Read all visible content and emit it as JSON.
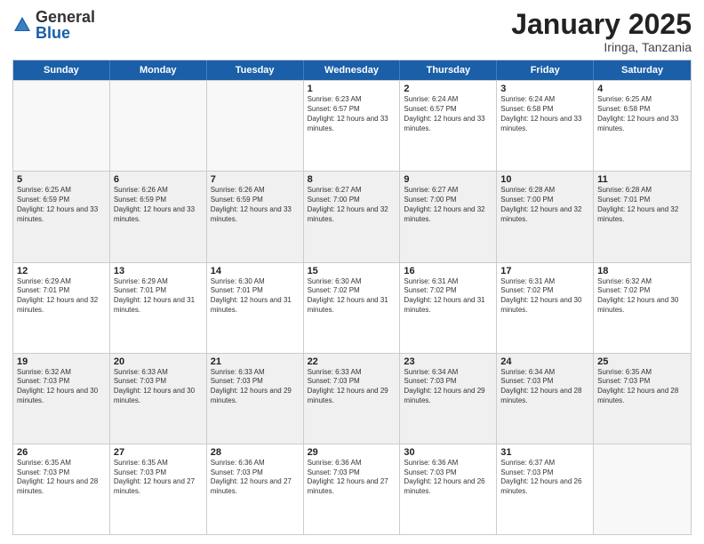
{
  "header": {
    "logo_general": "General",
    "logo_blue": "Blue",
    "title": "January 2025",
    "location": "Iringa, Tanzania"
  },
  "days_of_week": [
    "Sunday",
    "Monday",
    "Tuesday",
    "Wednesday",
    "Thursday",
    "Friday",
    "Saturday"
  ],
  "weeks": [
    [
      {
        "day": "",
        "text": ""
      },
      {
        "day": "",
        "text": ""
      },
      {
        "day": "",
        "text": ""
      },
      {
        "day": "1",
        "text": "Sunrise: 6:23 AM\nSunset: 6:57 PM\nDaylight: 12 hours and 33 minutes."
      },
      {
        "day": "2",
        "text": "Sunrise: 6:24 AM\nSunset: 6:57 PM\nDaylight: 12 hours and 33 minutes."
      },
      {
        "day": "3",
        "text": "Sunrise: 6:24 AM\nSunset: 6:58 PM\nDaylight: 12 hours and 33 minutes."
      },
      {
        "day": "4",
        "text": "Sunrise: 6:25 AM\nSunset: 6:58 PM\nDaylight: 12 hours and 33 minutes."
      }
    ],
    [
      {
        "day": "5",
        "text": "Sunrise: 6:25 AM\nSunset: 6:59 PM\nDaylight: 12 hours and 33 minutes."
      },
      {
        "day": "6",
        "text": "Sunrise: 6:26 AM\nSunset: 6:59 PM\nDaylight: 12 hours and 33 minutes."
      },
      {
        "day": "7",
        "text": "Sunrise: 6:26 AM\nSunset: 6:59 PM\nDaylight: 12 hours and 33 minutes."
      },
      {
        "day": "8",
        "text": "Sunrise: 6:27 AM\nSunset: 7:00 PM\nDaylight: 12 hours and 32 minutes."
      },
      {
        "day": "9",
        "text": "Sunrise: 6:27 AM\nSunset: 7:00 PM\nDaylight: 12 hours and 32 minutes."
      },
      {
        "day": "10",
        "text": "Sunrise: 6:28 AM\nSunset: 7:00 PM\nDaylight: 12 hours and 32 minutes."
      },
      {
        "day": "11",
        "text": "Sunrise: 6:28 AM\nSunset: 7:01 PM\nDaylight: 12 hours and 32 minutes."
      }
    ],
    [
      {
        "day": "12",
        "text": "Sunrise: 6:29 AM\nSunset: 7:01 PM\nDaylight: 12 hours and 32 minutes."
      },
      {
        "day": "13",
        "text": "Sunrise: 6:29 AM\nSunset: 7:01 PM\nDaylight: 12 hours and 31 minutes."
      },
      {
        "day": "14",
        "text": "Sunrise: 6:30 AM\nSunset: 7:01 PM\nDaylight: 12 hours and 31 minutes."
      },
      {
        "day": "15",
        "text": "Sunrise: 6:30 AM\nSunset: 7:02 PM\nDaylight: 12 hours and 31 minutes."
      },
      {
        "day": "16",
        "text": "Sunrise: 6:31 AM\nSunset: 7:02 PM\nDaylight: 12 hours and 31 minutes."
      },
      {
        "day": "17",
        "text": "Sunrise: 6:31 AM\nSunset: 7:02 PM\nDaylight: 12 hours and 30 minutes."
      },
      {
        "day": "18",
        "text": "Sunrise: 6:32 AM\nSunset: 7:02 PM\nDaylight: 12 hours and 30 minutes."
      }
    ],
    [
      {
        "day": "19",
        "text": "Sunrise: 6:32 AM\nSunset: 7:03 PM\nDaylight: 12 hours and 30 minutes."
      },
      {
        "day": "20",
        "text": "Sunrise: 6:33 AM\nSunset: 7:03 PM\nDaylight: 12 hours and 30 minutes."
      },
      {
        "day": "21",
        "text": "Sunrise: 6:33 AM\nSunset: 7:03 PM\nDaylight: 12 hours and 29 minutes."
      },
      {
        "day": "22",
        "text": "Sunrise: 6:33 AM\nSunset: 7:03 PM\nDaylight: 12 hours and 29 minutes."
      },
      {
        "day": "23",
        "text": "Sunrise: 6:34 AM\nSunset: 7:03 PM\nDaylight: 12 hours and 29 minutes."
      },
      {
        "day": "24",
        "text": "Sunrise: 6:34 AM\nSunset: 7:03 PM\nDaylight: 12 hours and 28 minutes."
      },
      {
        "day": "25",
        "text": "Sunrise: 6:35 AM\nSunset: 7:03 PM\nDaylight: 12 hours and 28 minutes."
      }
    ],
    [
      {
        "day": "26",
        "text": "Sunrise: 6:35 AM\nSunset: 7:03 PM\nDaylight: 12 hours and 28 minutes."
      },
      {
        "day": "27",
        "text": "Sunrise: 6:35 AM\nSunset: 7:03 PM\nDaylight: 12 hours and 27 minutes."
      },
      {
        "day": "28",
        "text": "Sunrise: 6:36 AM\nSunset: 7:03 PM\nDaylight: 12 hours and 27 minutes."
      },
      {
        "day": "29",
        "text": "Sunrise: 6:36 AM\nSunset: 7:03 PM\nDaylight: 12 hours and 27 minutes."
      },
      {
        "day": "30",
        "text": "Sunrise: 6:36 AM\nSunset: 7:03 PM\nDaylight: 12 hours and 26 minutes."
      },
      {
        "day": "31",
        "text": "Sunrise: 6:37 AM\nSunset: 7:03 PM\nDaylight: 12 hours and 26 minutes."
      },
      {
        "day": "",
        "text": ""
      }
    ]
  ]
}
